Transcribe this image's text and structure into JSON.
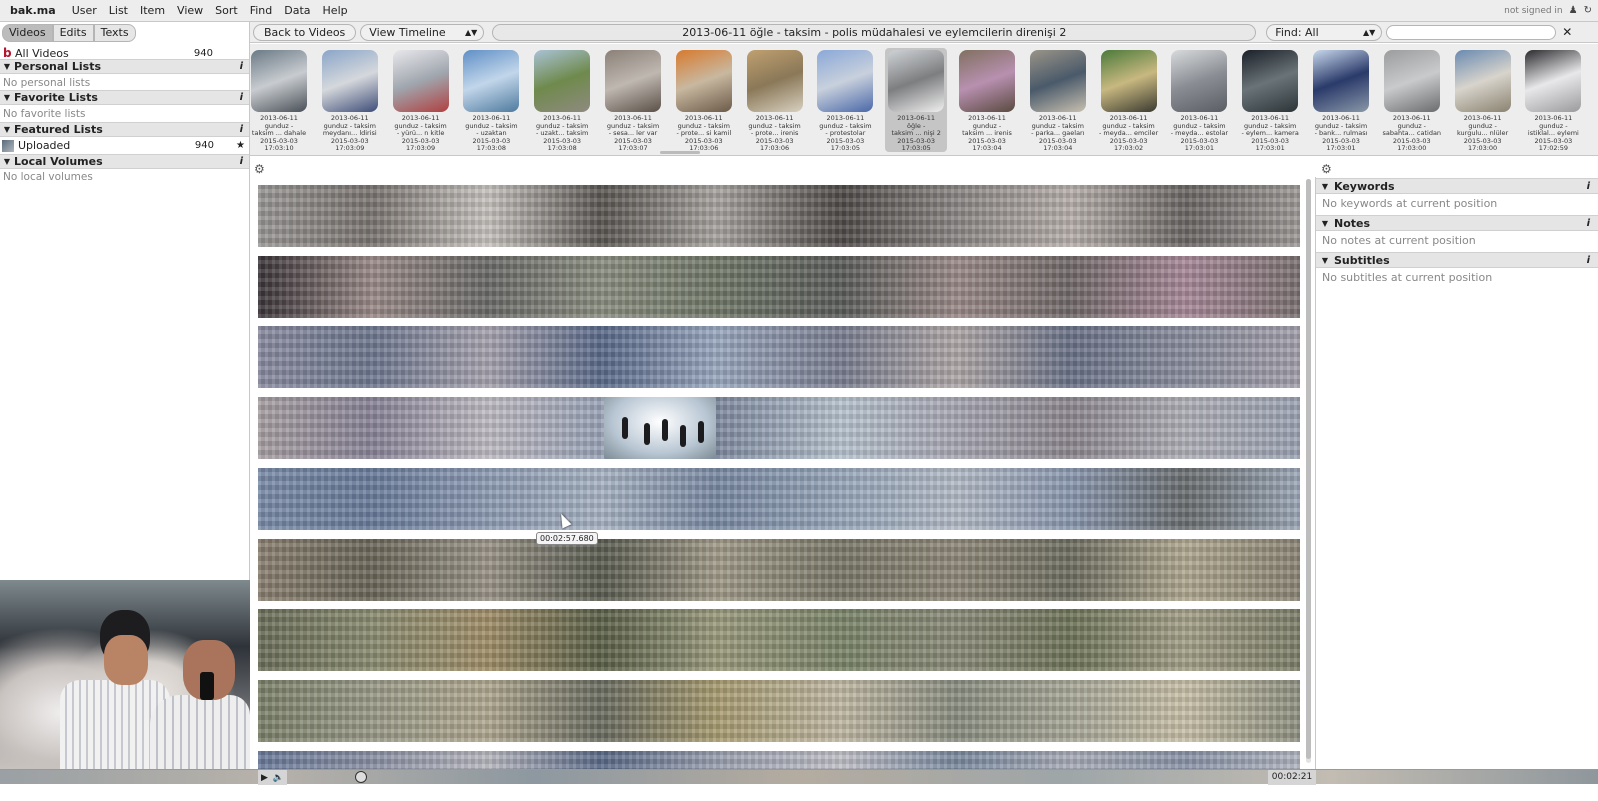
{
  "menubar": {
    "logo": "bak.ma",
    "items": [
      "User",
      "List",
      "Item",
      "View",
      "Sort",
      "Find",
      "Data",
      "Help"
    ],
    "status": "not signed in"
  },
  "sidebar": {
    "tabs": [
      {
        "label": "Videos",
        "active": true
      },
      {
        "label": "Edits",
        "active": false
      },
      {
        "label": "Texts",
        "active": false
      }
    ],
    "all_videos": {
      "label": "All Videos",
      "count": "940"
    },
    "sections": [
      {
        "title": "Personal Lists",
        "empty": "No personal lists"
      },
      {
        "title": "Favorite Lists",
        "empty": "No favorite lists"
      },
      {
        "title": "Featured Lists",
        "item": {
          "label": "Uploaded",
          "count": "940"
        }
      },
      {
        "title": "Local Volumes",
        "empty": "No local volumes"
      }
    ]
  },
  "toolbar": {
    "back_label": "Back to Videos",
    "view_select": "View Timeline",
    "title": "2013-06-11 öğle - taksim - polis müdahalesi ve eylemcilerin direnişi 2",
    "find_select": "Find: All",
    "search_placeholder": ""
  },
  "thumbnails": [
    {
      "line1": "2013-06-11",
      "line2": "gunduz -",
      "line3": "taksim ... dahale",
      "line4": "2015-03-03",
      "line5": "17:03:10",
      "colors": [
        "#6b7a86",
        "#c8ccd0",
        "#4a5058"
      ],
      "selected": false
    },
    {
      "line1": "2013-06-11",
      "line2": "gunduz - taksim",
      "line3": "meydanı... ldirisi",
      "line4": "2015-03-03",
      "line5": "17:03:09",
      "colors": [
        "#8aa5c8",
        "#d5d8dc",
        "#3e4d78"
      ],
      "selected": false
    },
    {
      "line1": "2013-06-11",
      "line2": "gunduz - taksim",
      "line3": "- yürü... n kitle",
      "line4": "2015-03-03",
      "line5": "17:03:09",
      "colors": [
        "#e8e8ec",
        "#a0a6ae",
        "#b04040"
      ],
      "selected": false
    },
    {
      "line1": "2013-06-11",
      "line2": "gunduz - taksim",
      "line3": "- uzaktan",
      "line4": "2015-03-03",
      "line5": "17:03:08",
      "colors": [
        "#5f8fc6",
        "#c2d6ea",
        "#4e7a9e"
      ],
      "selected": false
    },
    {
      "line1": "2013-06-11",
      "line2": "gunduz - taksim",
      "line3": "- uzakt... taksim",
      "line4": "2015-03-03",
      "line5": "17:03:08",
      "colors": [
        "#a9c2d6",
        "#6f8a4c",
        "#8f8a80"
      ],
      "selected": false
    },
    {
      "line1": "2013-06-11",
      "line2": "gunduz - taksim",
      "line3": "- sesa... ler var",
      "line4": "2015-03-03",
      "line5": "17:03:07",
      "colors": [
        "#8a8078",
        "#bfb8b0",
        "#5a5048"
      ],
      "selected": false
    },
    {
      "line1": "2013-06-11",
      "line2": "gunduz - taksim",
      "line3": "- prote... si kamil",
      "line4": "2015-03-03",
      "line5": "17:03:06",
      "colors": [
        "#d87a2e",
        "#c8b8a0",
        "#6a5a48"
      ],
      "selected": false
    },
    {
      "line1": "2013-06-11",
      "line2": "gunduz - taksim",
      "line3": "- prote... irenis",
      "line4": "2015-03-03",
      "line5": "17:03:06",
      "colors": [
        "#c0a070",
        "#8a7858",
        "#d8d0c0"
      ],
      "selected": false
    },
    {
      "line1": "2013-06-11",
      "line2": "gunduz - taksim",
      "line3": "- protestolar",
      "line4": "2015-03-03",
      "line5": "17:03:05",
      "colors": [
        "#8aa8d8",
        "#c8d0dc",
        "#4a68a8"
      ],
      "selected": false
    },
    {
      "line1": "2013-06-11",
      "line2": "öğle -",
      "line3": "taksim ... nişi 2",
      "line4": "2015-03-03",
      "line5": "17:03:05",
      "colors": [
        "#cfd3d6",
        "#7d7e80",
        "#f0f0f0"
      ],
      "selected": true
    },
    {
      "line1": "2013-06-11",
      "line2": "gunduz -",
      "line3": "taksim ... irenis",
      "line4": "2015-03-03",
      "line5": "17:03:04",
      "colors": [
        "#807060",
        "#b890b0",
        "#5a4a40"
      ],
      "selected": false
    },
    {
      "line1": "2013-06-11",
      "line2": "gunduz - taksim",
      "line3": "- parka... gaeları",
      "line4": "2015-03-03",
      "line5": "17:03:04",
      "colors": [
        "#9a9488",
        "#4a5a6a",
        "#c8c0b0"
      ],
      "selected": false
    },
    {
      "line1": "2013-06-11",
      "line2": "gunduz - taksim",
      "line3": "- meyda... emciler",
      "line4": "2015-03-03",
      "line5": "17:03:02",
      "colors": [
        "#4a7a3a",
        "#c8b880",
        "#3a3a30"
      ],
      "selected": false
    },
    {
      "line1": "2013-06-11",
      "line2": "gunduz - taksim",
      "line3": "- meyda... estolar",
      "line4": "2015-03-03",
      "line5": "17:03:01",
      "colors": [
        "#d8dadc",
        "#8a8e94",
        "#5a5e64"
      ],
      "selected": false
    },
    {
      "line1": "2013-06-11",
      "line2": "gunduz - taksim",
      "line3": "- eylem... kamera",
      "line4": "2015-03-03",
      "line5": "17:03:01",
      "colors": [
        "#1a2028",
        "#6a7478",
        "#2c3438"
      ],
      "selected": false
    },
    {
      "line1": "2013-06-11",
      "line2": "gunduz - taksim",
      "line3": "- bank... rulması",
      "line4": "2015-03-03",
      "line5": "17:03:01",
      "colors": [
        "#c8d8ec",
        "#2a3a6a",
        "#8a98a8"
      ],
      "selected": false
    },
    {
      "line1": "2013-06-11",
      "line2": "gunduz -",
      "line3": "sabahta... catidan",
      "line4": "2015-03-03",
      "line5": "17:03:00",
      "colors": [
        "#9a9c9e",
        "#c8cacc",
        "#6a6c6e"
      ],
      "selected": false
    },
    {
      "line1": "2013-06-11",
      "line2": "gunduz -",
      "line3": "kurgulu... nlüler",
      "line4": "2015-03-03",
      "line5": "17:03:00",
      "colors": [
        "#6a8ab0",
        "#d8d4cc",
        "#8a8270"
      ],
      "selected": false
    },
    {
      "line1": "2013-06-11",
      "line2": "gunduz -",
      "line3": "istiklal... eylemi",
      "line4": "2015-03-03",
      "line5": "17:02:59",
      "colors": [
        "#2a2a2e",
        "#e8e8ea",
        "#9a9a9c"
      ],
      "selected": false
    }
  ],
  "timeline": {
    "rows": [
      {
        "colors": [
          "#9a9896",
          "#7a7470",
          "#c8c4c0",
          "#5a5652",
          "#a8a4a0",
          "#4e4a48",
          "#8a8684",
          "#b8b0ac",
          "#6a6664",
          "#9e9a98"
        ]
      },
      {
        "colors": [
          "#3a3438",
          "#9a8a88",
          "#6a6a68",
          "#8a8e80",
          "#707868",
          "#5a5c5a",
          "#9a8a88",
          "#706868",
          "#a88898",
          "#7a7070"
        ]
      },
      {
        "colors": [
          "#8a8ca0",
          "#6e7890",
          "#a8a4b0",
          "#5a6a8a",
          "#9aa8c0",
          "#7a7e90",
          "#b0a8a8",
          "#6a7288",
          "#8a8e9e",
          "#a4a0ac"
        ]
      },
      {
        "colors": [
          "#a8a0a4",
          "#8a8498",
          "#c0bcc4",
          "#9aa4b8",
          "#7e8aa0",
          "#b8c4d0",
          "#a8a8b4",
          "#8e8890",
          "#b0b0b8",
          "#9ca4b4"
        ]
      },
      {
        "colors": [
          "#7a8ca8",
          "#6a7c9c",
          "#8e9cb4",
          "#a8b4c4",
          "#7a8aa4",
          "#98a8bc",
          "#b4bcc8",
          "#8a98b0",
          "#6a6e70",
          "#9ca8b8"
        ]
      },
      {
        "colors": [
          "#8a8070",
          "#6a6658",
          "#9a9488",
          "#5a5c50",
          "#a09a88",
          "#7a7868",
          "#8e8878",
          "#6e6e60",
          "#b0a890",
          "#8a8474"
        ]
      },
      {
        "colors": [
          "#6a6e58",
          "#8a8c70",
          "#a08e68",
          "#5a6048",
          "#9a9a7c",
          "#7a8468",
          "#8a8a78",
          "#6e7458",
          "#a4a088",
          "#7c7e68"
        ]
      },
      {
        "colors": [
          "#7a8068",
          "#9a9a88",
          "#b0a890",
          "#6a6c60",
          "#a89c70",
          "#c0b8a4",
          "#8a8e80",
          "#a8a898",
          "#c8c0a8",
          "#8e9080"
        ]
      },
      {
        "colors": [
          "#6a7a9a",
          "#8a90a4",
          "#b8b8c0",
          "#5a6a88",
          "#9aa0b0",
          "#c0c0c8",
          "#7a8aa0",
          "#a8acb8",
          "#8a94a8",
          "#b0b4c0"
        ]
      }
    ],
    "tooltip": "00:02:57.680"
  },
  "player": {
    "time": "00:02:21"
  },
  "right_panel": {
    "sections": [
      {
        "title": "Keywords",
        "empty": "No keywords at current position"
      },
      {
        "title": "Notes",
        "empty": "No notes at current position"
      },
      {
        "title": "Subtitles",
        "empty": "No subtitles at current position"
      }
    ]
  }
}
